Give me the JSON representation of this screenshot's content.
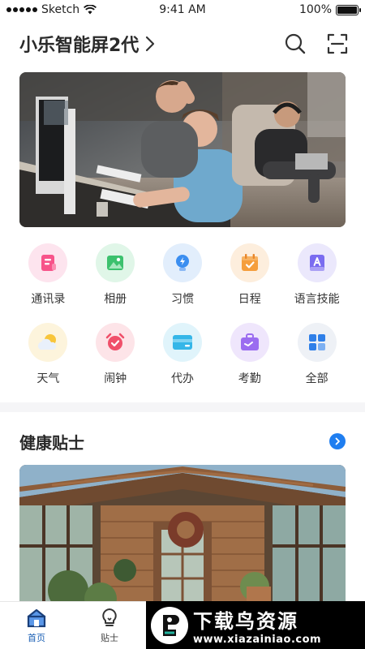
{
  "status_bar": {
    "carrier": "Sketch",
    "time": "9:41 AM",
    "battery": "100%"
  },
  "header": {
    "title": "小乐智能屏2代",
    "chevron_icon": "chevron-right-icon",
    "search_icon": "search-icon",
    "scan_icon": "scan-icon"
  },
  "banner": {
    "image": "office-workers-photo"
  },
  "shortcuts": [
    {
      "label": "通讯录",
      "icon": "contacts-icon",
      "color": "#f7548a",
      "bg": "#fde4ee"
    },
    {
      "label": "相册",
      "icon": "album-icon",
      "color": "#3cc16d",
      "bg": "#e0f6e8"
    },
    {
      "label": "习惯",
      "icon": "habit-icon",
      "color": "#3b8ef0",
      "bg": "#e2eefc"
    },
    {
      "label": "日程",
      "icon": "calendar-icon",
      "color": "#f59e3c",
      "bg": "#fdeedd"
    },
    {
      "label": "语言技能",
      "icon": "language-icon",
      "color": "#7a6cf0",
      "bg": "#ebe8fc"
    },
    {
      "label": "天气",
      "icon": "weather-icon",
      "color": "#f8c53a",
      "bg": "#fdf4dc"
    },
    {
      "label": "闹钟",
      "icon": "alarm-icon",
      "color": "#f0506a",
      "bg": "#fde4e8"
    },
    {
      "label": "代办",
      "icon": "todo-icon",
      "color": "#35b6e8",
      "bg": "#e0f4fb"
    },
    {
      "label": "考勤",
      "icon": "attendance-icon",
      "color": "#9b6cf0",
      "bg": "#efe6fc"
    },
    {
      "label": "全部",
      "icon": "all-apps-icon",
      "color": "#2f7fe8",
      "bg": "#eef1f6"
    }
  ],
  "health": {
    "title": "健康贴士",
    "more_icon": "chevron-right-circle-icon",
    "image": "greenhouse-photo"
  },
  "tabbar": [
    {
      "label": "首页",
      "icon": "home-icon",
      "active": true
    },
    {
      "label": "贴士",
      "icon": "bulb-icon",
      "active": false
    }
  ],
  "watermark": {
    "main": "下载鸟资源",
    "url": "www.xiazainiao.com"
  }
}
